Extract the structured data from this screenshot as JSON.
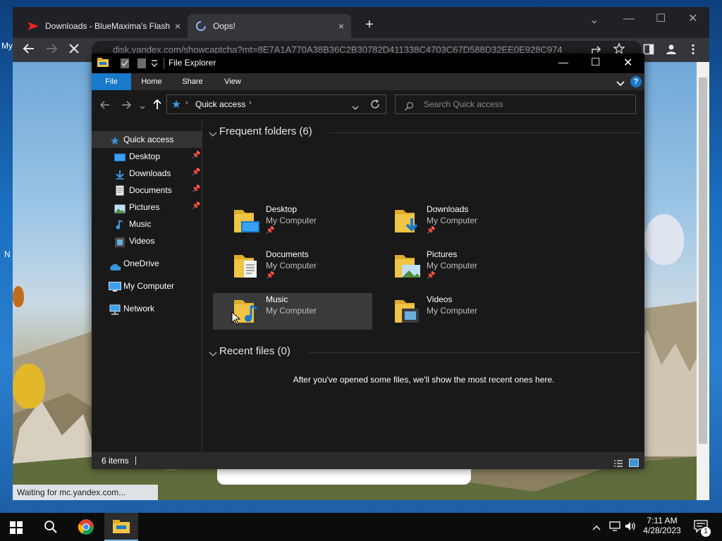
{
  "desktop": {
    "icon_labels": [
      "My",
      "N"
    ]
  },
  "browser": {
    "tabs": [
      {
        "title": "Downloads - BlueMaxima's Flash",
        "close": "×"
      },
      {
        "title": "Oops!",
        "close": "×"
      }
    ],
    "new_tab": "+",
    "url": "disk.yandex.com/showcaptcha?mt=8E7A1A770A38B36C2B30782D411338C4703C67D588D32EE0E928C974",
    "status_text": "Waiting for mc.yandex.com...",
    "window_controls": {
      "minimize": "—",
      "maximize": "☐",
      "close": "✕"
    },
    "tab_search": "⌄"
  },
  "explorer": {
    "title": "File Explorer",
    "window_controls": {
      "minimize": "—",
      "maximize": "☐",
      "close": "✕"
    },
    "ribbon_tabs": [
      "File",
      "Home",
      "Share",
      "View"
    ],
    "help": "?",
    "breadcrumb": "Quick access",
    "search_placeholder": "Search Quick access",
    "nav": {
      "quick_access": "Quick access",
      "items": [
        {
          "label": "Desktop",
          "pinned": true
        },
        {
          "label": "Downloads",
          "pinned": true
        },
        {
          "label": "Documents",
          "pinned": true
        },
        {
          "label": "Pictures",
          "pinned": true
        },
        {
          "label": "Music",
          "pinned": false
        },
        {
          "label": "Videos",
          "pinned": false
        }
      ],
      "onedrive": "OneDrive",
      "my_computer": "My Computer",
      "network": "Network"
    },
    "frequent_header": "Frequent folders (6)",
    "folders": [
      {
        "name": "Desktop",
        "location": "My Computer",
        "pinned": true
      },
      {
        "name": "Downloads",
        "location": "My Computer",
        "pinned": true
      },
      {
        "name": "Documents",
        "location": "My Computer",
        "pinned": true
      },
      {
        "name": "Pictures",
        "location": "My Computer",
        "pinned": true
      },
      {
        "name": "Music",
        "location": "My Computer",
        "pinned": false
      },
      {
        "name": "Videos",
        "location": "My Computer",
        "pinned": false
      }
    ],
    "recent_header": "Recent files (0)",
    "recent_empty": "After you've opened some files, we'll show the most recent ones here.",
    "status_items": "6 items"
  },
  "taskbar": {
    "time": "7:11 AM",
    "date": "4/28/2023",
    "notification_count": "1"
  },
  "colors": {
    "accent": "#1979ca",
    "folder_yellow": "#f0c445",
    "chrome_dark": "#202124"
  }
}
